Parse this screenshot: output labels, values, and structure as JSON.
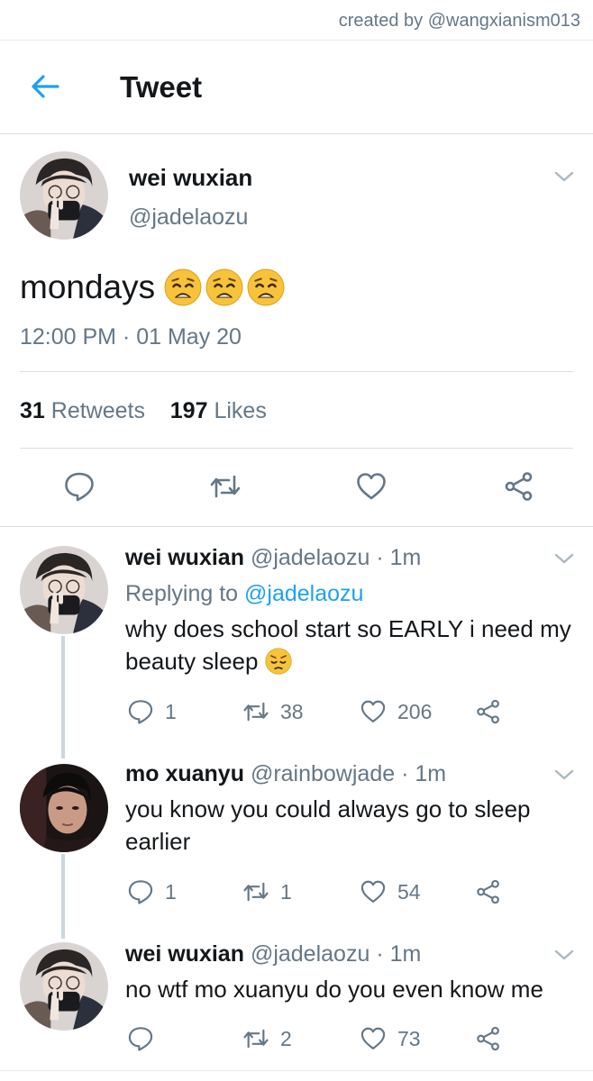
{
  "credit": "created by @wangxianism013",
  "header": {
    "title": "Tweet"
  },
  "main_tweet": {
    "name": "wei wuxian",
    "handle": "@jadelaozu",
    "text": "mondays",
    "emoji": [
      "weary-face-emoji",
      "weary-face-emoji",
      "weary-face-emoji"
    ],
    "time": "12:00 PM · 01 May 20",
    "retweets_count": "31",
    "retweets_label": "Retweets",
    "likes_count": "197",
    "likes_label": "Likes"
  },
  "replies": [
    {
      "name": "wei wuxian",
      "handle": "@jadelaozu",
      "time": "· 1m",
      "replying_label": "Replying to",
      "replying_to": "@jadelaozu",
      "text": "why does school start so EARLY i need my beauty sleep",
      "emoji": "pensive-face-emoji",
      "reply_count": "1",
      "retweet_count": "38",
      "like_count": "206"
    },
    {
      "name": "mo xuanyu",
      "handle": "@rainbowjade",
      "time": "· 1m",
      "text": "you know you could always go to sleep earlier",
      "reply_count": "1",
      "retweet_count": "1",
      "like_count": "54"
    },
    {
      "name": "wei wuxian",
      "handle": "@jadelaozu",
      "time": "· 1m",
      "text": "no wtf mo xuanyu do you even know me",
      "reply_count": "",
      "retweet_count": "2",
      "like_count": "73"
    }
  ],
  "colors": {
    "accent": "#1da1f2",
    "muted": "#657786",
    "text": "#14171a",
    "divider": "#d8dee2"
  }
}
